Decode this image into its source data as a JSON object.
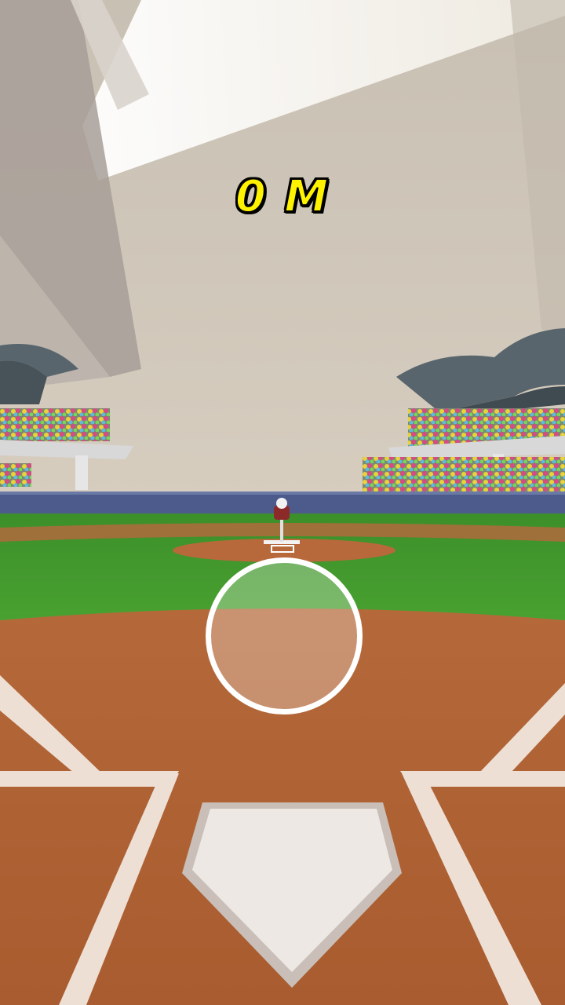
{
  "hud": {
    "distance_value": "0",
    "distance_unit": "M"
  },
  "scene": {
    "elements": {
      "pitching_machine": "pitching-machine",
      "home_plate": "home-plate",
      "aim_target": "aim-ring"
    },
    "colors": {
      "hud_text": "#fff200",
      "hud_outline": "#000000",
      "grass": "#3f9a2a",
      "dirt": "#b86a3a",
      "wall": "#4d5b8c",
      "sky_wall": "#cfc6b8",
      "chalk": "#f2e4dc",
      "aim_ring": "#ffffff"
    }
  }
}
